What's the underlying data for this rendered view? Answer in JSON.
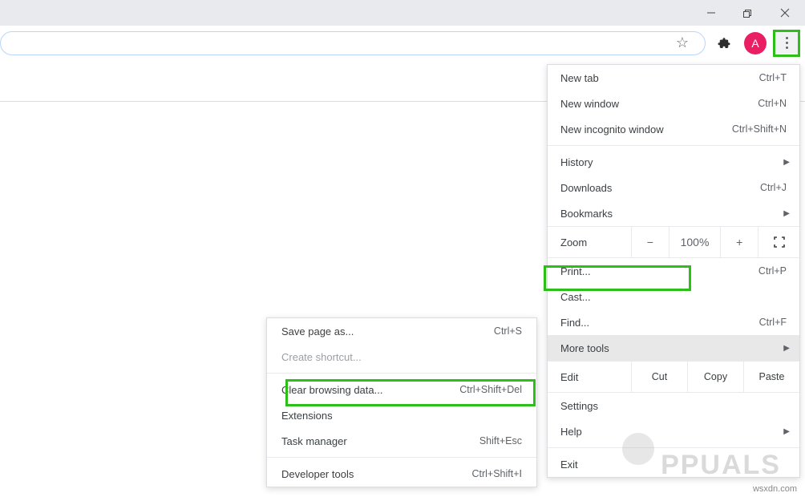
{
  "window": {
    "minimize": "–",
    "restore": "❐",
    "close": "✕"
  },
  "toolbar": {
    "star": "☆",
    "avatar_letter": "A"
  },
  "menu": {
    "new_tab": {
      "label": "New tab",
      "shortcut": "Ctrl+T"
    },
    "new_window": {
      "label": "New window",
      "shortcut": "Ctrl+N"
    },
    "new_incognito": {
      "label": "New incognito window",
      "shortcut": "Ctrl+Shift+N"
    },
    "history": {
      "label": "History"
    },
    "downloads": {
      "label": "Downloads",
      "shortcut": "Ctrl+J"
    },
    "bookmarks": {
      "label": "Bookmarks"
    },
    "zoom": {
      "label": "Zoom",
      "minus": "−",
      "value": "100%",
      "plus": "+"
    },
    "print": {
      "label": "Print...",
      "shortcut": "Ctrl+P"
    },
    "cast": {
      "label": "Cast..."
    },
    "find": {
      "label": "Find...",
      "shortcut": "Ctrl+F"
    },
    "more_tools": {
      "label": "More tools"
    },
    "edit": {
      "label": "Edit",
      "cut": "Cut",
      "copy": "Copy",
      "paste": "Paste"
    },
    "settings": {
      "label": "Settings"
    },
    "help": {
      "label": "Help"
    },
    "exit": {
      "label": "Exit"
    }
  },
  "submenu": {
    "save_as": {
      "label": "Save page as...",
      "shortcut": "Ctrl+S"
    },
    "create_shortcut": {
      "label": "Create shortcut..."
    },
    "clear_data": {
      "label": "Clear browsing data...",
      "shortcut": "Ctrl+Shift+Del"
    },
    "extensions": {
      "label": "Extensions"
    },
    "task_manager": {
      "label": "Task manager",
      "shortcut": "Shift+Esc"
    },
    "dev_tools": {
      "label": "Developer tools",
      "shortcut": "Ctrl+Shift+I"
    }
  },
  "footer": {
    "watermark": "wsxdn.com",
    "brand": "PPUALS"
  }
}
